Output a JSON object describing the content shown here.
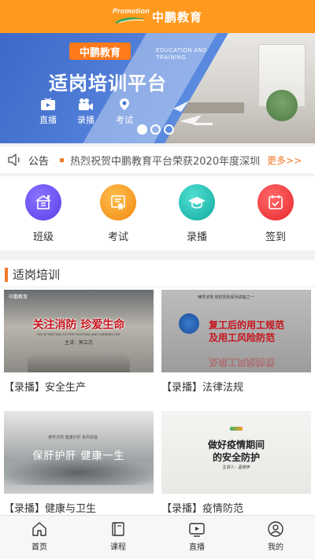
{
  "header": {
    "logo_text": "Promotion",
    "title": "中鹏教育"
  },
  "banner": {
    "brand": "中鹏教育",
    "tagline_en": "EDUCATION AND TRAINING",
    "title": "适岗培训平台",
    "features": [
      {
        "label": "直播",
        "icon": "tv-icon"
      },
      {
        "label": "录播",
        "icon": "video-camera-icon"
      },
      {
        "label": "考试",
        "icon": "location-pin-icon"
      }
    ],
    "slide_count": 3,
    "active_slide": 1
  },
  "notice": {
    "label": "公告",
    "text": "热烈祝贺中鹏教育平台荣获2020年度深圳",
    "more": "更多>>"
  },
  "quick_menu": [
    {
      "label": "班级",
      "icon": "classroom-icon",
      "color": "#6b4ef0"
    },
    {
      "label": "考试",
      "icon": "certificate-icon",
      "color": "#f39a1d"
    },
    {
      "label": "录播",
      "icon": "graduation-cap-icon",
      "color": "#1fb8b0"
    },
    {
      "label": "签到",
      "icon": "calendar-check-icon",
      "color": "#f03a3a"
    }
  ],
  "section": {
    "title": "适岗培训",
    "courses": [
      {
        "title": "【录播】安全生产",
        "thumb": {
          "logo": "中鹏教育",
          "headline": "关注消防 珍爱生命",
          "sub": "PAY ATTENTION TO FIRE FIGHTING AND CHERISH LIFE",
          "speaker": "主讲：郭立志"
        }
      },
      {
        "title": "【录播】法律法规",
        "thumb": {
          "top": "律学法规 管控风险系列讲座之一",
          "line1": "复工后的用工规范",
          "line2": "及用工风险防范",
          "reflection": "及用工风险防范"
        }
      },
      {
        "title": "【录播】健康与卫生",
        "thumb": {
          "small": "律学法规 健康护肝 系列讲座",
          "big": "保肝护肝 健康一生"
        }
      },
      {
        "title": "【录播】疫情防范",
        "thumb": {
          "line1": "做好疫情期间",
          "line2": "的安全防护",
          "speaker": "主讲人：孟锦伊"
        }
      }
    ]
  },
  "bottom_nav": [
    {
      "label": "首页",
      "icon": "home-icon"
    },
    {
      "label": "课程",
      "icon": "book-icon"
    },
    {
      "label": "直播",
      "icon": "live-tv-icon"
    },
    {
      "label": "我的",
      "icon": "user-icon"
    }
  ]
}
